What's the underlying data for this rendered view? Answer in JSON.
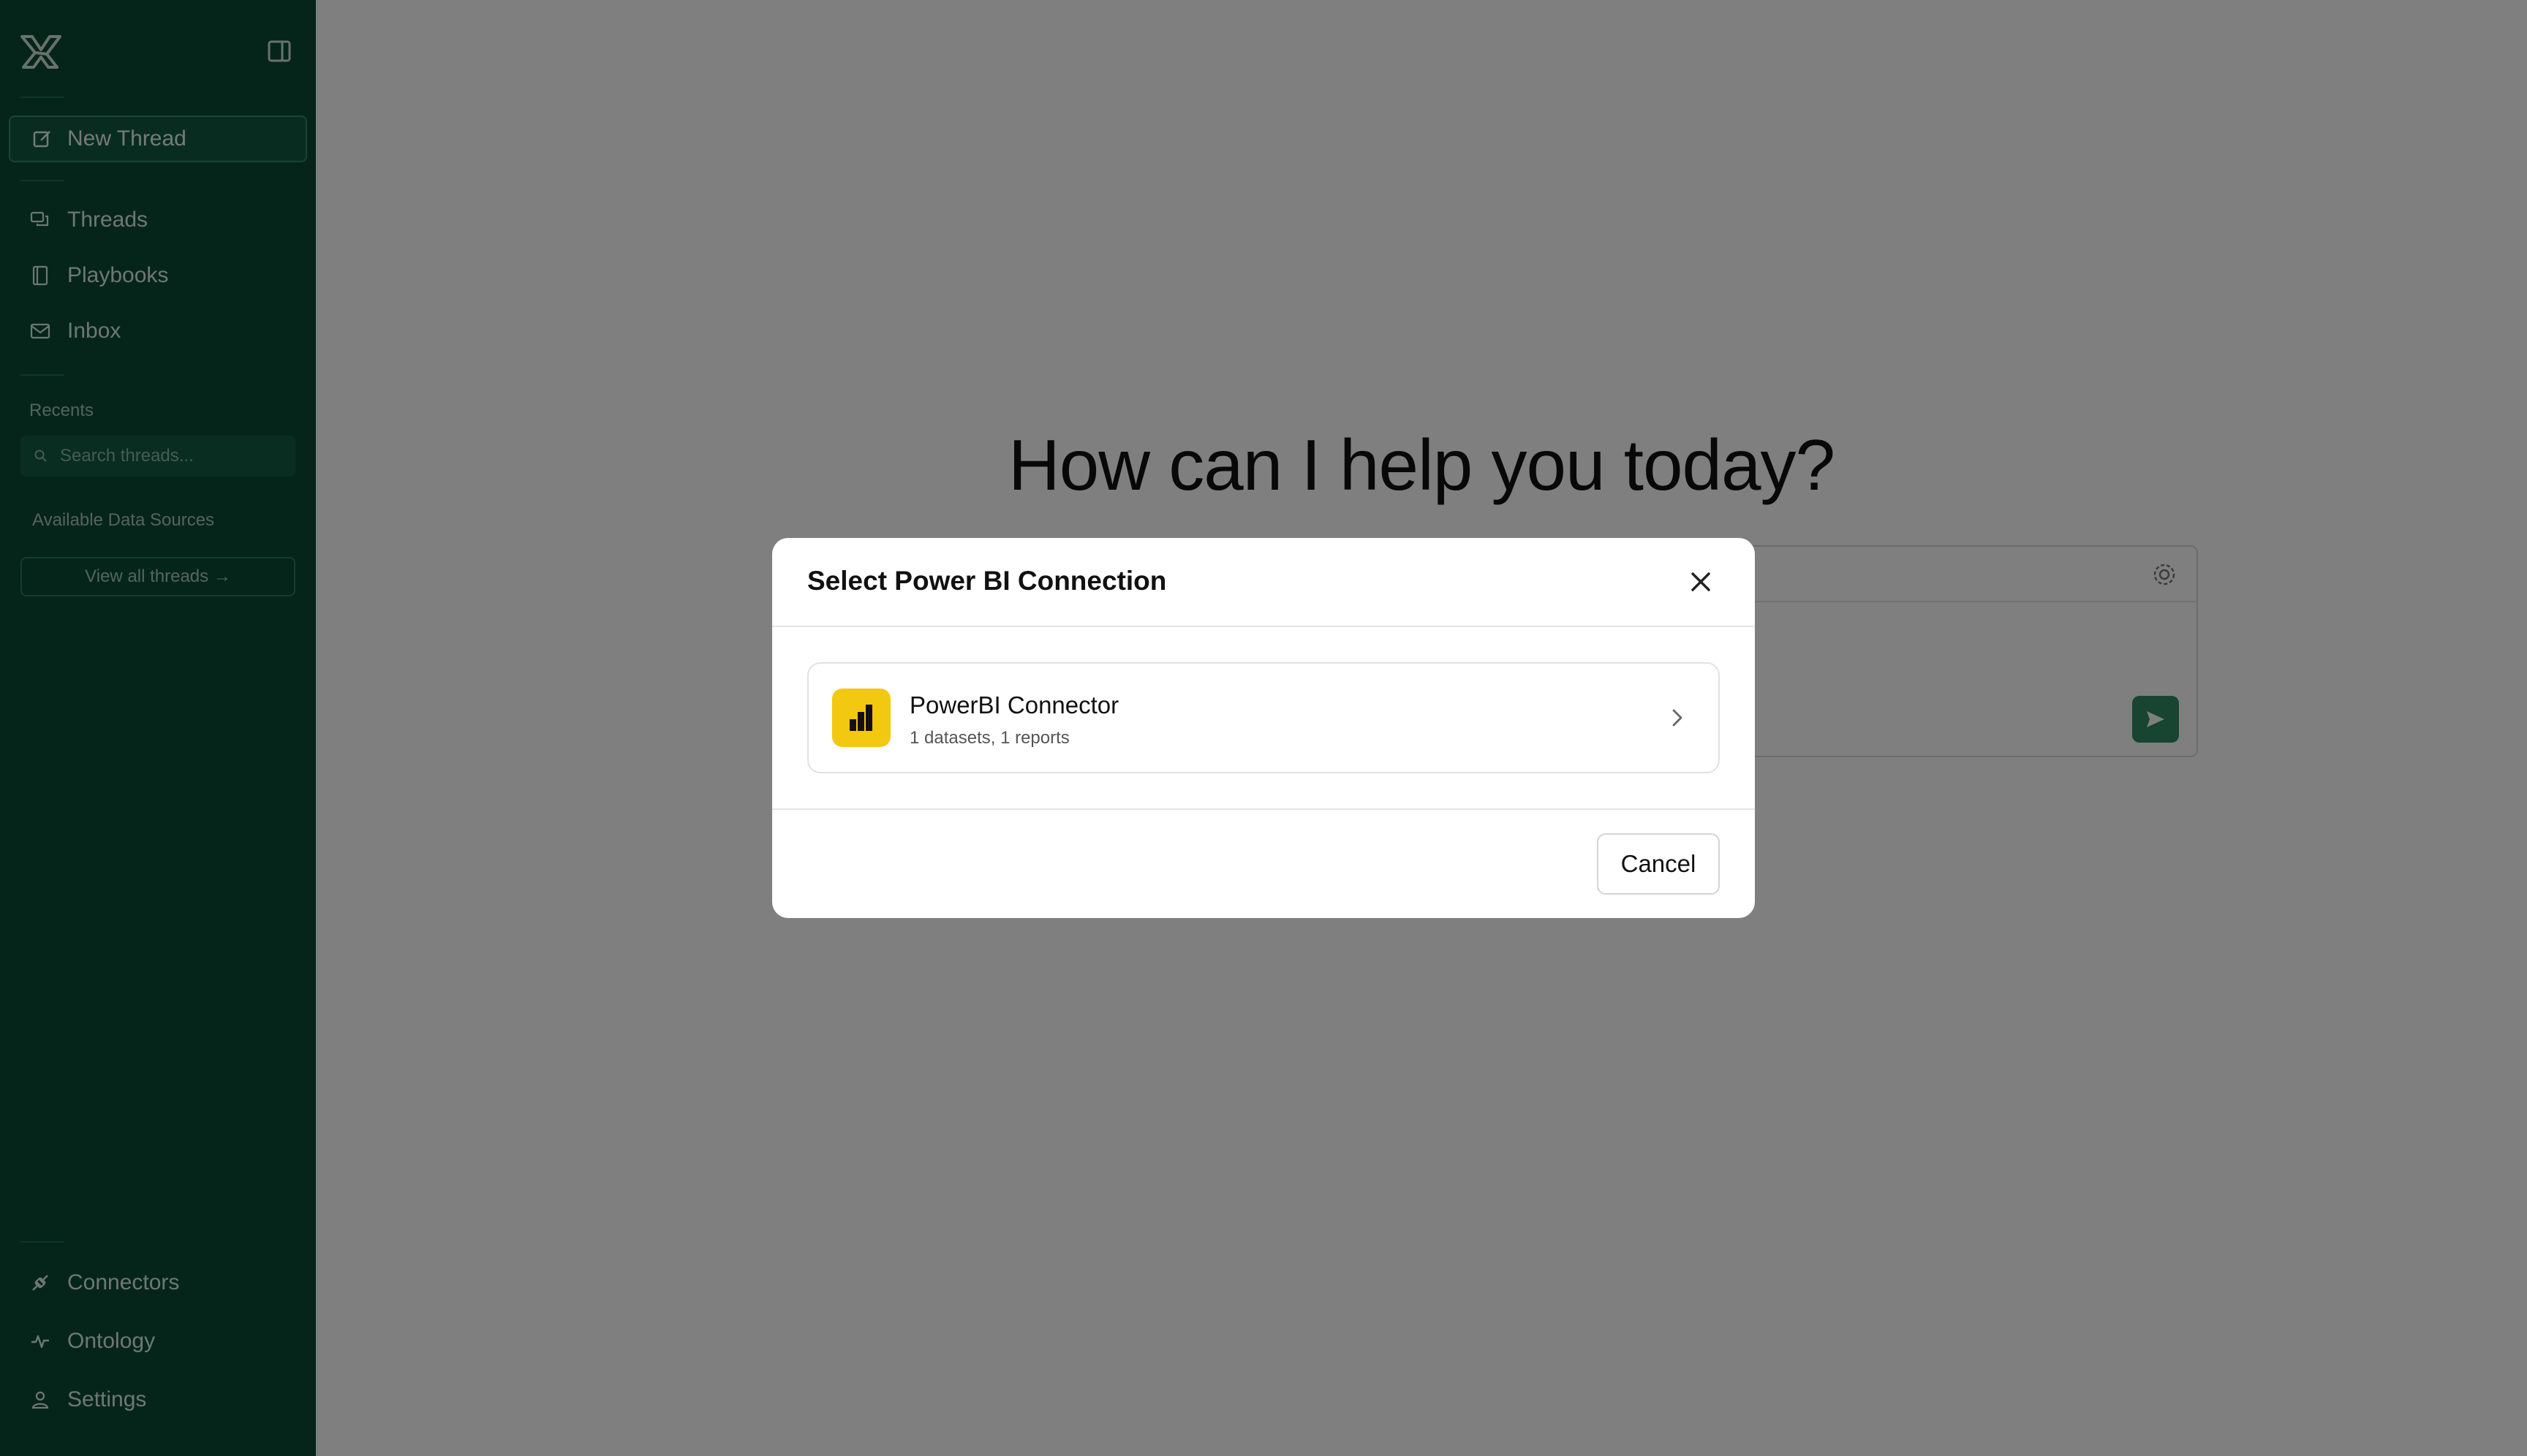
{
  "sidebar": {
    "new_thread_label": "New Thread",
    "nav": [
      {
        "label": "Threads",
        "icon": "threads-icon"
      },
      {
        "label": "Playbooks",
        "icon": "playbooks-icon"
      },
      {
        "label": "Inbox",
        "icon": "inbox-icon"
      }
    ],
    "recents_label": "Recents",
    "search_placeholder": "Search threads...",
    "data_sources_label": "Available Data Sources",
    "view_all_label": "View all threads →",
    "bottom_nav": [
      {
        "label": "Connectors",
        "icon": "connectors-icon"
      },
      {
        "label": "Ontology",
        "icon": "ontology-icon"
      },
      {
        "label": "Settings",
        "icon": "settings-user-icon"
      }
    ]
  },
  "main": {
    "hero_text": "How can I help you today?"
  },
  "modal": {
    "title": "Select Power BI Connection",
    "connection": {
      "name": "PowerBI Connector",
      "meta": "1 datasets, 1 reports"
    },
    "cancel_label": "Cancel"
  },
  "colors": {
    "sidebar_bg": "#0c4a35",
    "accent": "#2f8a63",
    "powerbi_yellow": "#f2c811",
    "overlay": "rgba(0,0,0,0.5)"
  }
}
